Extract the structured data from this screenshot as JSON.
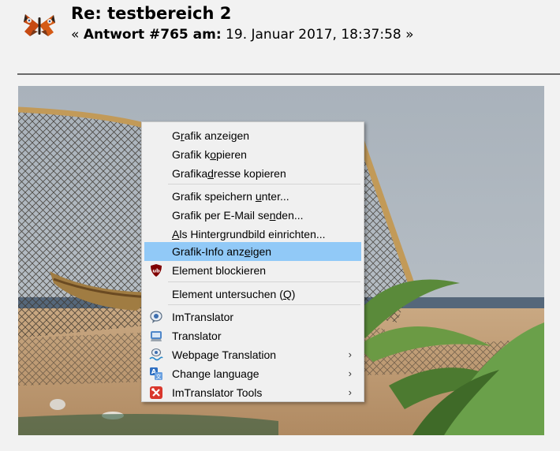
{
  "post": {
    "title": "Re: testbereich 2",
    "meta_open": "« ",
    "reply_label": "Antwort #765 am:",
    "date": " 19. Januar 2017, 18:37:58 »"
  },
  "context_menu": {
    "items": [
      {
        "pre": "G",
        "u": "r",
        "post": "afik anzeigen"
      },
      {
        "pre": "Grafik k",
        "u": "o",
        "post": "pieren"
      },
      {
        "pre": "Grafika",
        "u": "d",
        "post": "resse kopieren"
      },
      {
        "pre": "Grafik speichern ",
        "u": "u",
        "post": "nter..."
      },
      {
        "pre": "Grafik per E-Mail se",
        "u": "n",
        "post": "den..."
      },
      {
        "pre": "",
        "u": "A",
        "post": "ls Hintergrundbild einrichten..."
      },
      {
        "pre": "Grafik-Info anz",
        "u": "e",
        "post": "igen"
      },
      {
        "label": "Element blockieren"
      },
      {
        "pre": "Element untersuchen (",
        "u": "Q",
        "post": ")"
      },
      {
        "label": "ImTranslator"
      },
      {
        "label": "Translator"
      },
      {
        "label": "Webpage Translation"
      },
      {
        "label": "Change language"
      },
      {
        "label": "ImTranslator Tools"
      }
    ],
    "submenu_arrow": "›"
  },
  "colors": {
    "highlight": "#91c9f7",
    "ublock_red": "#800000",
    "tools_red": "#d9372c"
  },
  "icons": {
    "avatar": "butterfly-avatar",
    "ublock": "ublock-origin-icon",
    "imtranslator": "imtranslator-icon",
    "translator": "translator-icon",
    "webpage_translation": "webpage-translation-icon",
    "change_language": "change-language-icon",
    "tools": "imtranslator-tools-icon"
  }
}
